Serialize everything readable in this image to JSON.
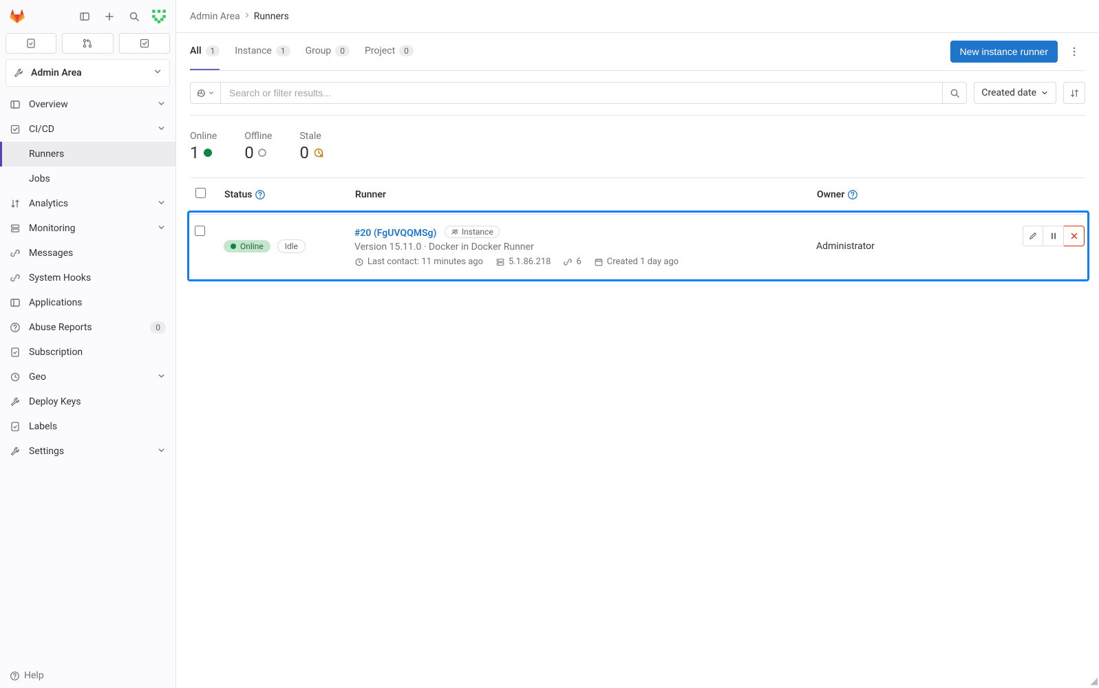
{
  "sidebar": {
    "context_title": "Admin Area",
    "items": [
      {
        "label": "Overview",
        "icon": "overview",
        "hasChevron": true
      },
      {
        "label": "CI/CD",
        "icon": "rocket",
        "hasChevron": true,
        "expanded": true,
        "children": [
          {
            "label": "Runners",
            "active": true
          },
          {
            "label": "Jobs"
          }
        ]
      },
      {
        "label": "Analytics",
        "icon": "chart",
        "hasChevron": true
      },
      {
        "label": "Monitoring",
        "icon": "monitor",
        "hasChevron": true
      },
      {
        "label": "Messages",
        "icon": "megaphone"
      },
      {
        "label": "System Hooks",
        "icon": "hook"
      },
      {
        "label": "Applications",
        "icon": "apps"
      },
      {
        "label": "Abuse Reports",
        "icon": "abuse",
        "badge": "0"
      },
      {
        "label": "Subscription",
        "icon": "license"
      },
      {
        "label": "Geo",
        "icon": "geo",
        "hasChevron": true
      },
      {
        "label": "Deploy Keys",
        "icon": "key"
      },
      {
        "label": "Labels",
        "icon": "tag"
      },
      {
        "label": "Settings",
        "icon": "gear",
        "hasChevron": true
      }
    ],
    "help_label": "Help"
  },
  "breadcrumbs": {
    "root": "Admin Area",
    "current": "Runners"
  },
  "tabs": [
    {
      "label": "All",
      "count": "1",
      "active": true
    },
    {
      "label": "Instance",
      "count": "1"
    },
    {
      "label": "Group",
      "count": "0"
    },
    {
      "label": "Project",
      "count": "0"
    }
  ],
  "actions": {
    "new_runner": "New instance runner"
  },
  "filter": {
    "placeholder": "Search or filter results...",
    "sort": "Created date"
  },
  "summary": {
    "online": {
      "label": "Online",
      "value": "1"
    },
    "offline": {
      "label": "Offline",
      "value": "0"
    },
    "stale": {
      "label": "Stale",
      "value": "0"
    }
  },
  "columns": {
    "status": "Status",
    "runner": "Runner",
    "owner": "Owner"
  },
  "runners": [
    {
      "status_pill": "Online",
      "idle_pill": "Idle",
      "link": "#20 (FgUVQQMSg)",
      "scope_pill": "Instance",
      "version_line": "Version 15.11.0 · Docker in Docker Runner",
      "last_contact": "Last contact: 11 minutes ago",
      "ip": "5.1.86.218",
      "jobs": "6",
      "created": "Created 1 day ago",
      "owner": "Administrator"
    }
  ]
}
